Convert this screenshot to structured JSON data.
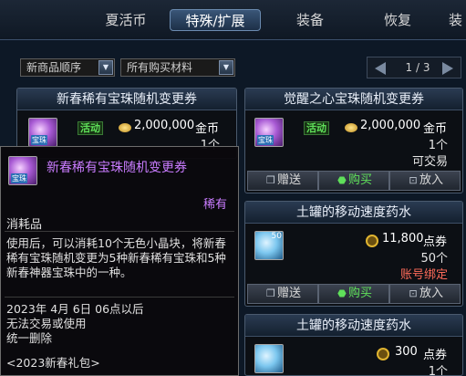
{
  "nav": {
    "tabs": [
      {
        "label": "夏活币",
        "active": false
      },
      {
        "label": "特殊/扩展",
        "active": true
      },
      {
        "label": "装备",
        "active": false
      },
      {
        "label": "恢复",
        "active": false
      },
      {
        "label": "装",
        "active": false
      }
    ]
  },
  "filters": {
    "sort": "新商品顺序",
    "material": "所有购买材料"
  },
  "pager": {
    "page": "1",
    "sep": "/",
    "total": "3"
  },
  "cards": [
    {
      "title": "新春稀有宝珠随机变更券",
      "event": "活动",
      "price": "2,000,000",
      "currency": "金币",
      "qty": "1个",
      "icon_badge": "宝珠"
    },
    {
      "title": "觉醒之心宝珠随机变更券",
      "event": "活动",
      "price": "2,000,000",
      "currency": "金币",
      "qty": "1个",
      "status": "可交易",
      "icon_badge": "宝珠",
      "actions": {
        "gift": "赠送",
        "buy": "购买",
        "cart": "放入"
      }
    },
    {
      "title": "土罐的移动速度药水",
      "price": "11,800",
      "currency": "点券",
      "qty": "50个",
      "status": "账号绑定",
      "icon_num": "50",
      "actions": {
        "gift": "赠送",
        "buy": "购买",
        "cart": "放入"
      }
    },
    {
      "title": "土罐的移动速度药水",
      "price": "300",
      "currency": "点券",
      "qty": "1个"
    }
  ],
  "tooltip": {
    "name": "新春稀有宝珠随机变更券",
    "icon_badge": "宝珠",
    "rarity": "稀有",
    "type": "消耗品",
    "desc": "使用后，可以消耗10个无色小晶块，将新春稀有宝珠随机变更为5种新春稀有宝珠和5种新春神器宝珠中的一种。",
    "date": "2023年 4月 6日 06点以后",
    "trade": "无法交易或使用",
    "delete": "统一删除",
    "pack": "<2023新春礼包>"
  },
  "colors": {
    "accent": "#c97cff",
    "buy": "#5fe05a",
    "bound": "#ff6b5a",
    "nav_active": "#3a5678"
  },
  "icons": {
    "gift": "gift-icon",
    "buy": "buy-icon",
    "cart": "cart-icon",
    "coin": "gold-coin-icon",
    "coupon": "coupon-icon"
  }
}
